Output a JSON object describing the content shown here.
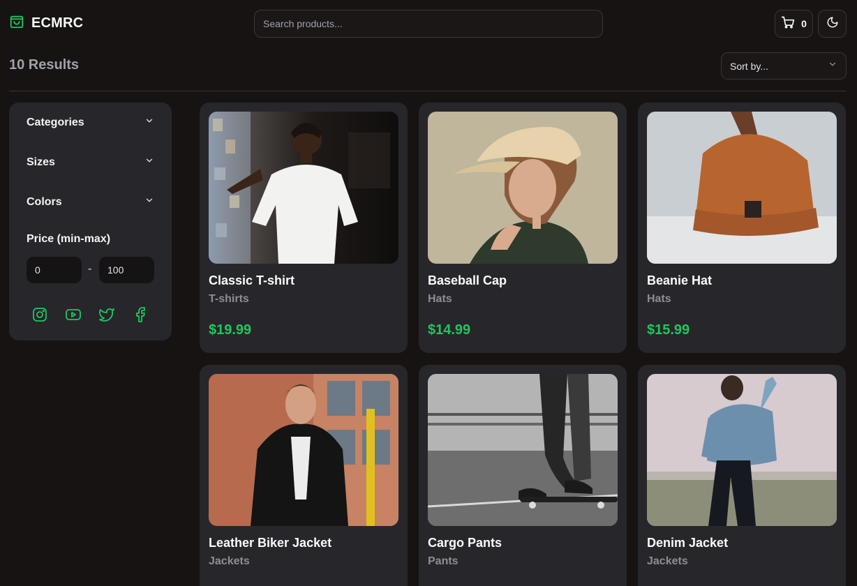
{
  "header": {
    "brand": "ECMRC",
    "search_placeholder": "Search products...",
    "cart_count": "0"
  },
  "toolbar": {
    "results": "10 Results",
    "sort_label": "Sort by..."
  },
  "sidebar": {
    "filters": [
      "Categories",
      "Sizes",
      "Colors"
    ],
    "price_label": "Price (min-max)",
    "price_min": "0",
    "price_max": "100",
    "separator": "-",
    "social_icons": [
      "instagram-icon",
      "youtube-icon",
      "twitter-icon",
      "facebook-icon"
    ]
  },
  "products": [
    {
      "title": "Classic T-shirt",
      "category": "T-shirts",
      "price": "$19.99",
      "image": "man-white-tshirt"
    },
    {
      "title": "Baseball Cap",
      "category": "Hats",
      "price": "$14.99",
      "image": "woman-beige-cap"
    },
    {
      "title": "Beanie Hat",
      "category": "Hats",
      "price": "$15.99",
      "image": "orange-beanie"
    },
    {
      "title": "Leather Biker Jacket",
      "category": "Jackets",
      "price": "",
      "image": "man-leather-jacket"
    },
    {
      "title": "Cargo Pants",
      "category": "Pants",
      "price": "",
      "image": "skateboarder-cargo-pants"
    },
    {
      "title": "Denim Jacket",
      "category": "Jackets",
      "price": "",
      "image": "man-denim-jacket"
    }
  ],
  "colors": {
    "accent": "#22c55e",
    "background": "#171312",
    "panel": "#27272b"
  }
}
